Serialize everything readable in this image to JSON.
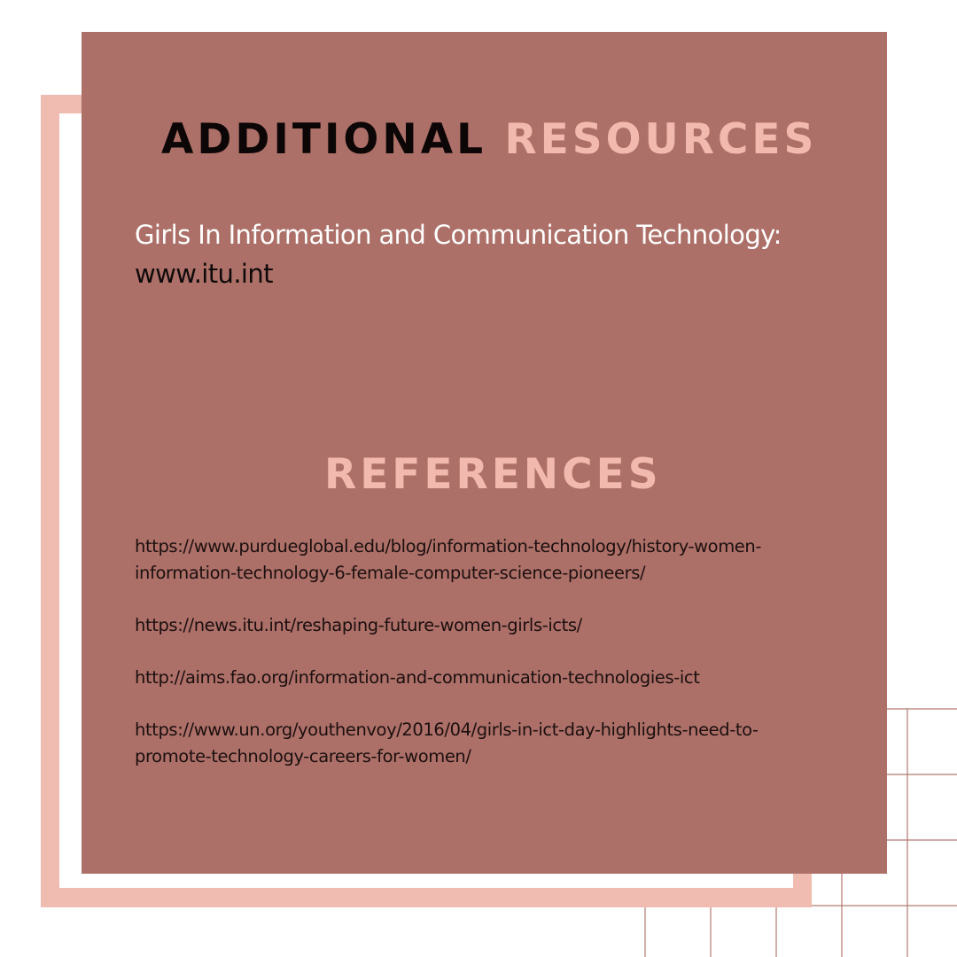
{
  "colors": {
    "card": "#ad7068",
    "frame": "#f0bcb2",
    "accent_text": "#f2b9ae",
    "dark_text": "#0c0606",
    "light_text": "#ffffff",
    "grid_lines": "#b57a72"
  },
  "additional_resources": {
    "heading_dark": "ADDITIONAL",
    "heading_light": "RESOURCES",
    "item_label": "Girls In Information and Communication Technology:",
    "item_link": "www.itu.int"
  },
  "references": {
    "heading": "REFERENCES",
    "items": [
      {
        "line1": "https://www.purdueglobal.edu/blog/information-technology/history-women-",
        "line2": "information-technology-6-female-computer-science-pioneers/"
      },
      {
        "line1": "https://news.itu.int/reshaping-future-women-girls-icts/",
        "line2": ""
      },
      {
        "line1": "http://aims.fao.org/information-and-communication-technologies-ict",
        "line2": ""
      },
      {
        "line1": "https://www.un.org/youthenvoy/2016/04/girls-in-ict-day-highlights-need-to-",
        "line2": "promote-technology-careers-for-women/"
      }
    ]
  }
}
